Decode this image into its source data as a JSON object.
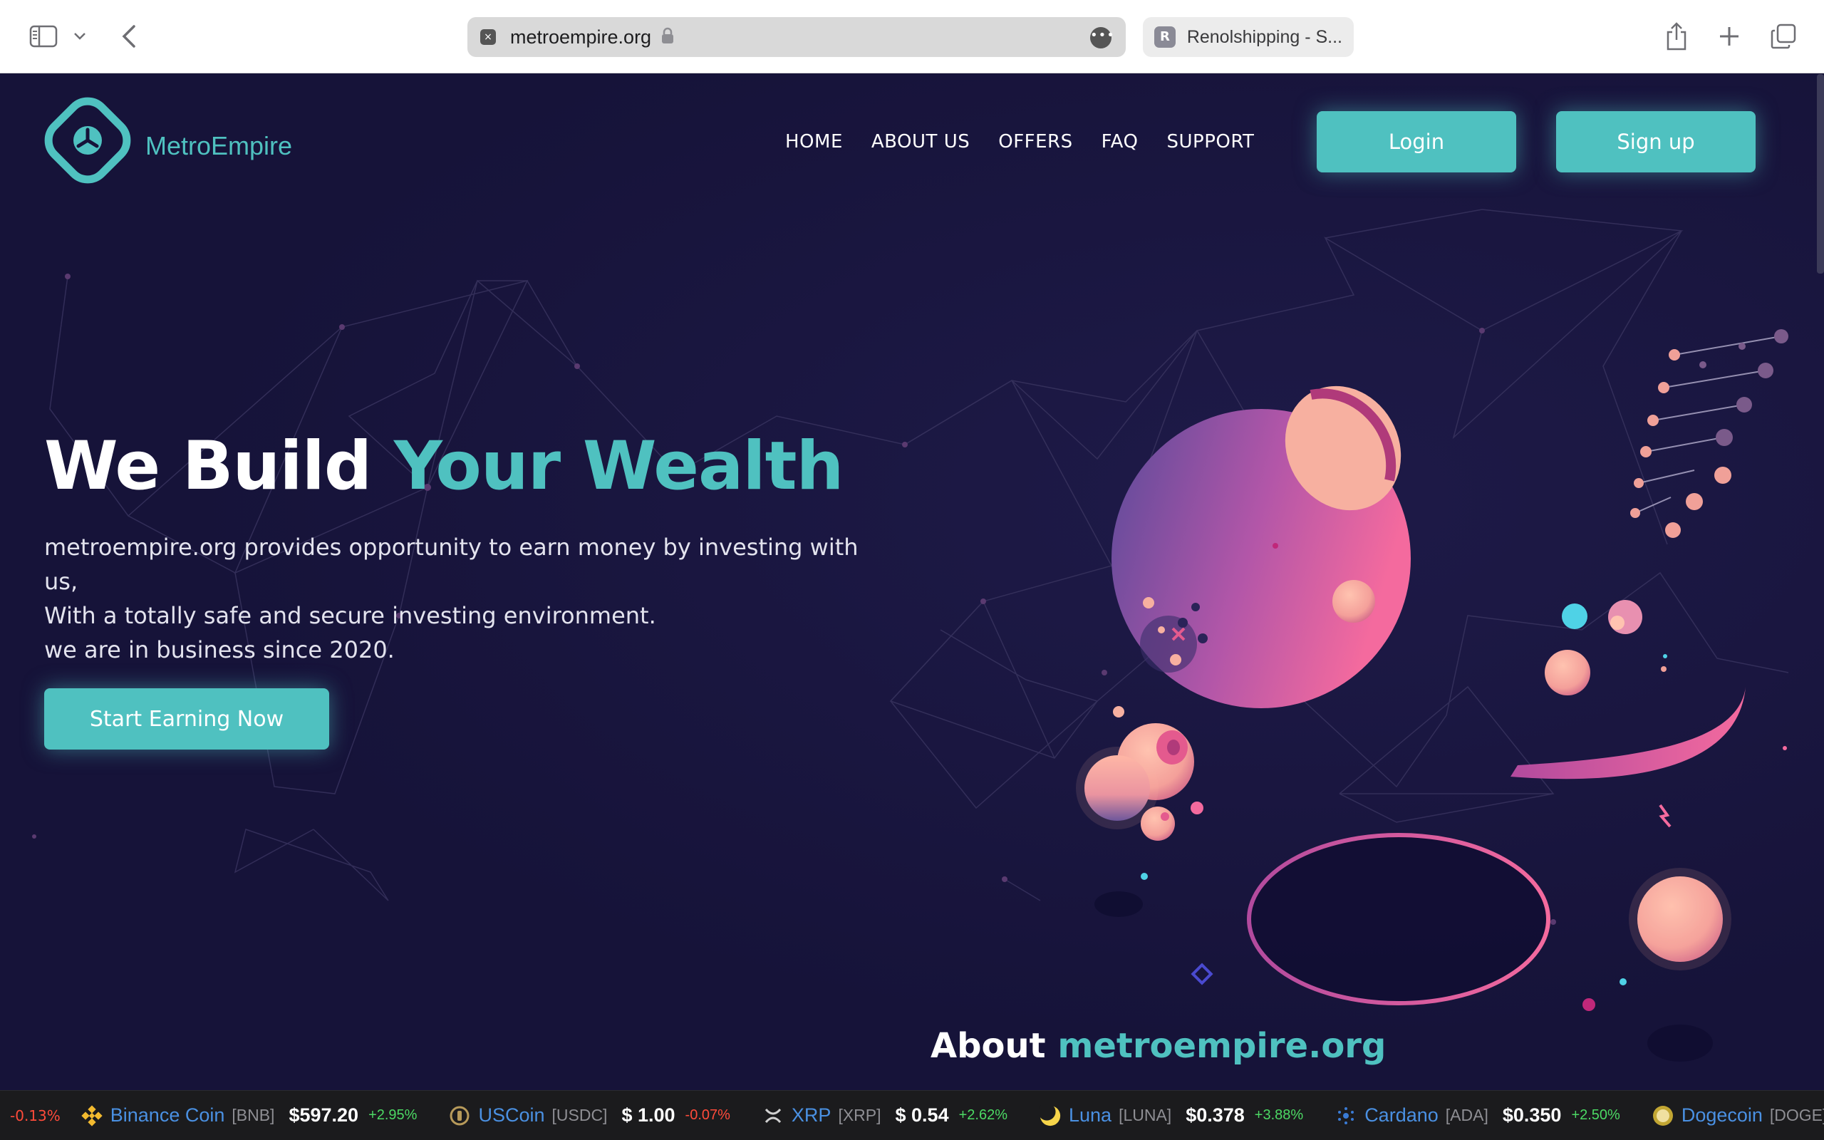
{
  "browser": {
    "url": "metroempire.org",
    "address_favicon": "×",
    "more_glyph": "•••",
    "tab2_favicon": "R",
    "tab2_title": "Renolshipping - S..."
  },
  "site": {
    "brand": "MetroEmpire",
    "accent_color": "#4fc1c0",
    "background_color": "#161339",
    "nav": [
      "HOME",
      "ABOUT US",
      "OFFERS",
      "FAQ",
      "SUPPORT"
    ],
    "login_label": "Login",
    "signup_label": "Sign up"
  },
  "hero": {
    "title_part1": "We Build ",
    "title_part2": "Your Wealth",
    "lines": [
      "metroempire.org provides opportunity to earn money by investing with us,",
      "With a totally safe and secure investing environment.",
      "we are in business since 2020."
    ],
    "cta_label": "Start Earning Now"
  },
  "about": {
    "title_part1": "About ",
    "title_part2": "metroempire.org"
  },
  "ticker": {
    "lead_change": "-0.13%",
    "items": [
      {
        "name": "Binance Coin",
        "symbol": "[BNB]",
        "price": "$597.20",
        "change": "+2.95%",
        "icon": "binance-icon"
      },
      {
        "name": "USCoin",
        "symbol": "[USDC]",
        "price": "$ 1.00",
        "change": "-0.07%",
        "icon": "usdc-icon"
      },
      {
        "name": "XRP",
        "symbol": "[XRP]",
        "price": "$ 0.54",
        "change": "+2.62%",
        "icon": "xrp-icon"
      },
      {
        "name": "Luna",
        "symbol": "[LUNA]",
        "price": "$0.378",
        "change": "+3.88%",
        "icon": "luna-icon"
      },
      {
        "name": "Cardano",
        "symbol": "[ADA]",
        "price": "$0.350",
        "change": "+2.50%",
        "icon": "cardano-icon"
      },
      {
        "name": "Dogecoin",
        "symbol": "[DOGE]",
        "price": "",
        "change": "",
        "icon": "dogecoin-icon"
      }
    ]
  }
}
